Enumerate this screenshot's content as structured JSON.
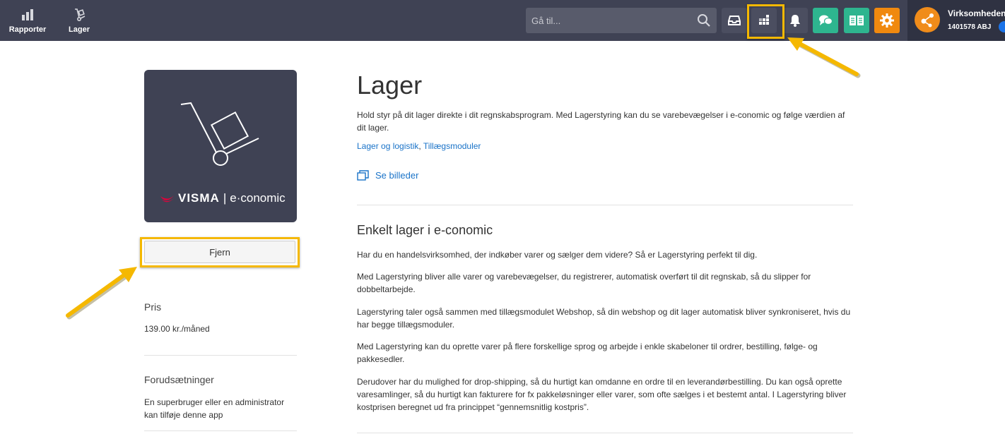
{
  "nav": {
    "reports_label": "Rapporter",
    "inventory_label": "Lager"
  },
  "search": {
    "placeholder": "Gå til..."
  },
  "toolbar": {
    "icons": [
      "inbox-icon",
      "apps-grid-icon",
      "bell-icon",
      "chat-icon",
      "book-icon",
      "gear-icon"
    ],
    "colors": {
      "dark": "#4b4e60",
      "green": "#2eb58f",
      "orange": "#f0890f",
      "highlight": "#f5b800"
    }
  },
  "user": {
    "name": "Virksomheden",
    "id": "1401578 ABJ"
  },
  "app": {
    "title": "Lager",
    "intro": "Hold styr på dit lager direkte i dit regnskabsprogram. Med Lagerstyring kan du se varebevægelser i e-conomic og følge værdien af dit lager.",
    "category_1": "Lager og logistik",
    "category_sep": ", ",
    "category_2": "Tillægsmoduler",
    "images_link": "Se billeder",
    "brand_visma": "VISMA",
    "brand_sep": "|",
    "brand_economic": "e·conomic"
  },
  "sidebar": {
    "remove_button": "Fjern",
    "price_heading": "Pris",
    "price_value": "139.00 kr./måned",
    "prereq_heading": "Forudsætninger",
    "prereq_text": "En superbruger eller en administrator kan tilføje denne app"
  },
  "content": {
    "heading": "Enkelt lager i e-conomic",
    "paragraphs": [
      "Har du en handelsvirksomhed, der indkøber varer og sælger dem videre? Så er Lagerstyring perfekt til dig.",
      "Med Lagerstyring bliver alle varer og varebevægelser, du registrerer, automatisk overført til dit regnskab, så du slipper for dobbeltarbejde.",
      "Lagerstyring taler også sammen med tillægsmodulet Webshop, så din webshop og dit lager automatisk bliver synkroniseret, hvis du har begge tillægsmoduler.",
      "Med Lagerstyring kan du oprette varer på flere forskellige sprog og arbejde i enkle skabeloner til ordrer, bestilling, følge- og pakkesedler.",
      "Derudover har du mulighed for drop-shipping, så du hurtigt kan omdanne en ordre til en leverandørbestilling. Du kan også oprette varesamlinger, så du hurtigt kan fakturere for fx pakkeløsninger eller varer, som ofte sælges i et bestemt antal. I Lagerstyring bliver kostprisen beregnet ud fra princippet “gennemsnitlig kostpris”."
    ]
  }
}
